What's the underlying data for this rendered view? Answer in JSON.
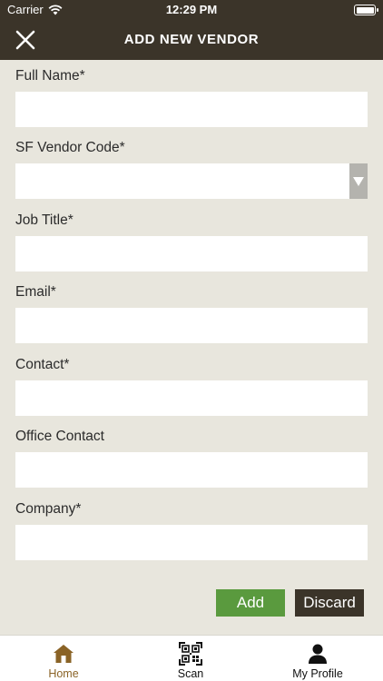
{
  "status_bar": {
    "carrier": "Carrier",
    "time": "12:29 PM"
  },
  "nav": {
    "title": "ADD NEW VENDOR"
  },
  "form": {
    "full_name": {
      "label": "Full Name*",
      "value": ""
    },
    "vendor_code": {
      "label": "SF Vendor Code*",
      "value": ""
    },
    "job_title": {
      "label": "Job Title*",
      "value": ""
    },
    "email": {
      "label": "Email*",
      "value": ""
    },
    "contact": {
      "label": "Contact*",
      "value": ""
    },
    "office_contact": {
      "label": "Office Contact",
      "value": ""
    },
    "company": {
      "label": "Company*",
      "value": ""
    }
  },
  "actions": {
    "add_label": "Add",
    "discard_label": "Discard"
  },
  "tabs": [
    {
      "label": "Home",
      "icon": "home-icon",
      "active": true
    },
    {
      "label": "Scan",
      "icon": "qr-scan-icon",
      "active": false
    },
    {
      "label": "My Profile",
      "icon": "person-icon",
      "active": false
    }
  ],
  "colors": {
    "header": "#3b3429",
    "background": "#e8e6dd",
    "add_button": "#5a9a3e",
    "active_tab": "#8a6326"
  }
}
